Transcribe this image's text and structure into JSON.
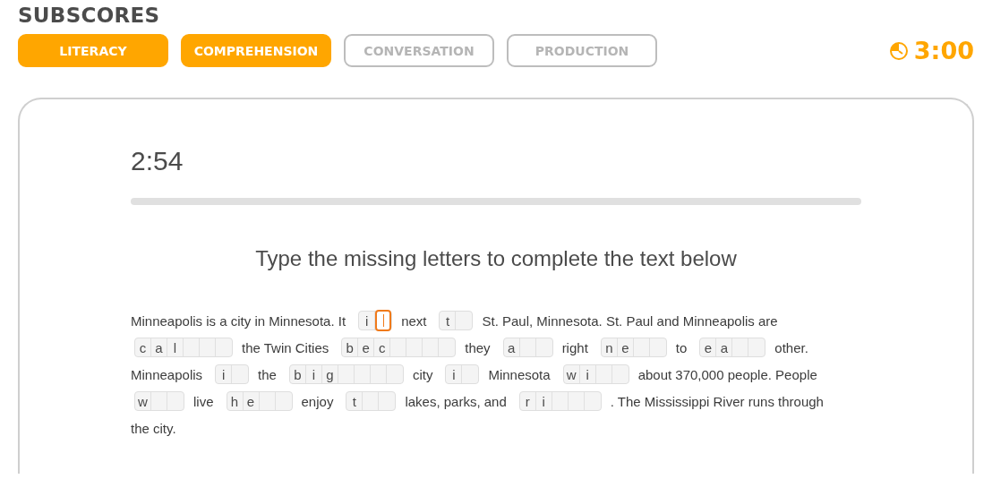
{
  "heading": "SUBSCORES",
  "tabs": [
    {
      "label": "LITERACY",
      "completed": true
    },
    {
      "label": "COMPREHENSION",
      "completed": true
    },
    {
      "label": "CONVERSATION",
      "completed": false
    },
    {
      "label": "PRODUCTION",
      "completed": false
    }
  ],
  "total_timer": "3:00",
  "card": {
    "timer": "2:54",
    "instruction": "Type the missing letters to complete the text below",
    "passage_lines": [
      [
        {
          "kind": "text",
          "text": "Minneapolis is a city in Minnesota. It"
        },
        {
          "kind": "blank",
          "cells": [
            {
              "kind": "given",
              "letter": "i"
            },
            {
              "kind": "empty",
              "focused": true
            }
          ]
        },
        {
          "kind": "text",
          "text": "next"
        },
        {
          "kind": "blank",
          "cells": [
            {
              "kind": "given",
              "letter": "t"
            },
            {
              "kind": "empty",
              "focused": false
            }
          ]
        },
        {
          "kind": "text",
          "text": "St. Paul, Minnesota. St. Paul and Minneapolis are"
        }
      ],
      [
        {
          "kind": "blank",
          "cells": [
            {
              "kind": "given",
              "letter": "c"
            },
            {
              "kind": "given",
              "letter": "a"
            },
            {
              "kind": "given",
              "letter": "l"
            },
            {
              "kind": "empty",
              "focused": false
            },
            {
              "kind": "empty",
              "focused": false
            },
            {
              "kind": "empty",
              "focused": false
            }
          ]
        },
        {
          "kind": "text",
          "text": "the Twin Cities"
        },
        {
          "kind": "blank",
          "cells": [
            {
              "kind": "given",
              "letter": "b"
            },
            {
              "kind": "given",
              "letter": "e"
            },
            {
              "kind": "given",
              "letter": "c"
            },
            {
              "kind": "empty",
              "focused": false
            },
            {
              "kind": "empty",
              "focused": false
            },
            {
              "kind": "empty",
              "focused": false
            },
            {
              "kind": "empty",
              "focused": false
            }
          ]
        },
        {
          "kind": "text",
          "text": "they"
        },
        {
          "kind": "blank",
          "cells": [
            {
              "kind": "given",
              "letter": "a"
            },
            {
              "kind": "empty",
              "focused": false
            },
            {
              "kind": "empty",
              "focused": false
            }
          ]
        },
        {
          "kind": "text",
          "text": "right"
        },
        {
          "kind": "blank",
          "cells": [
            {
              "kind": "given",
              "letter": "n"
            },
            {
              "kind": "given",
              "letter": "e"
            },
            {
              "kind": "empty",
              "focused": false
            },
            {
              "kind": "empty",
              "focused": false
            }
          ]
        },
        {
          "kind": "text",
          "text": "to"
        },
        {
          "kind": "blank",
          "cells": [
            {
              "kind": "given",
              "letter": "e"
            },
            {
              "kind": "given",
              "letter": "a"
            },
            {
              "kind": "empty",
              "focused": false
            },
            {
              "kind": "empty",
              "focused": false
            }
          ]
        },
        {
          "kind": "text",
          "text": "other."
        }
      ],
      [
        {
          "kind": "text",
          "text": "Minneapolis"
        },
        {
          "kind": "blank",
          "cells": [
            {
              "kind": "given",
              "letter": "i"
            },
            {
              "kind": "empty",
              "focused": false
            }
          ]
        },
        {
          "kind": "text",
          "text": "the"
        },
        {
          "kind": "blank",
          "cells": [
            {
              "kind": "given",
              "letter": "b"
            },
            {
              "kind": "given",
              "letter": "i"
            },
            {
              "kind": "given",
              "letter": "g"
            },
            {
              "kind": "empty",
              "focused": false
            },
            {
              "kind": "empty",
              "focused": false
            },
            {
              "kind": "empty",
              "focused": false
            },
            {
              "kind": "empty",
              "focused": false
            }
          ]
        },
        {
          "kind": "text",
          "text": "city"
        },
        {
          "kind": "blank",
          "cells": [
            {
              "kind": "given",
              "letter": "i"
            },
            {
              "kind": "empty",
              "focused": false
            }
          ]
        },
        {
          "kind": "text",
          "text": "Minnesota"
        },
        {
          "kind": "blank",
          "cells": [
            {
              "kind": "given",
              "letter": "w"
            },
            {
              "kind": "given",
              "letter": "i"
            },
            {
              "kind": "empty",
              "focused": false
            },
            {
              "kind": "empty",
              "focused": false
            }
          ]
        },
        {
          "kind": "text",
          "text": "about 370,000 people. People"
        }
      ],
      [
        {
          "kind": "blank",
          "cells": [
            {
              "kind": "given",
              "letter": "w"
            },
            {
              "kind": "empty",
              "focused": false
            },
            {
              "kind": "empty",
              "focused": false
            }
          ]
        },
        {
          "kind": "text",
          "text": "live"
        },
        {
          "kind": "blank",
          "cells": [
            {
              "kind": "given",
              "letter": "h"
            },
            {
              "kind": "given",
              "letter": "e"
            },
            {
              "kind": "empty",
              "focused": false
            },
            {
              "kind": "empty",
              "focused": false
            }
          ]
        },
        {
          "kind": "text",
          "text": "enjoy"
        },
        {
          "kind": "blank",
          "cells": [
            {
              "kind": "given",
              "letter": "t"
            },
            {
              "kind": "empty",
              "focused": false
            },
            {
              "kind": "empty",
              "focused": false
            }
          ]
        },
        {
          "kind": "text",
          "text": "lakes, parks, and"
        },
        {
          "kind": "blank",
          "cells": [
            {
              "kind": "given",
              "letter": "r"
            },
            {
              "kind": "given",
              "letter": "i"
            },
            {
              "kind": "empty",
              "focused": false
            },
            {
              "kind": "empty",
              "focused": false
            },
            {
              "kind": "empty",
              "focused": false
            }
          ]
        },
        {
          "kind": "text",
          "text": ". The Mississippi River runs through"
        }
      ],
      [
        {
          "kind": "text",
          "text": "the city."
        }
      ]
    ]
  }
}
